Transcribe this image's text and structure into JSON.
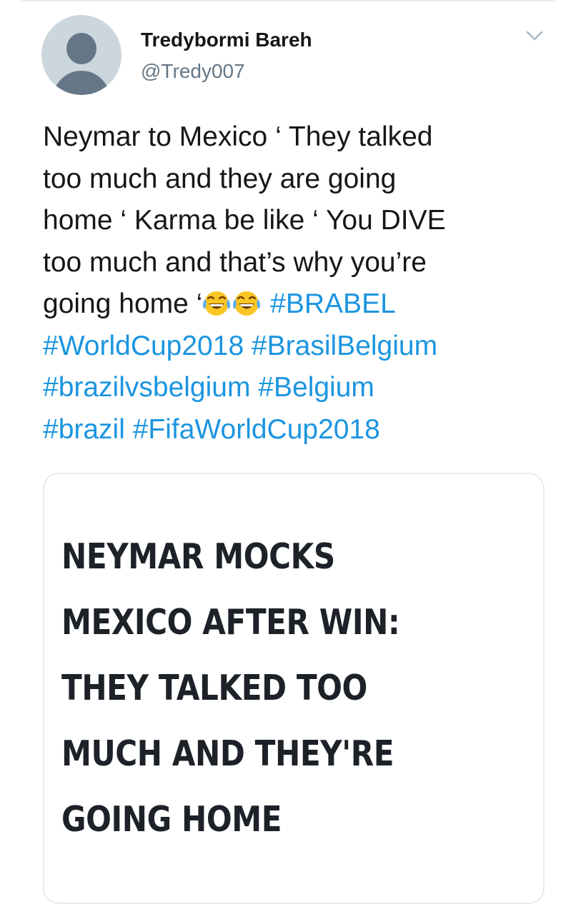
{
  "author": {
    "display_name": "Tredybormi Bareh",
    "handle": "@Tredy007"
  },
  "tweet": {
    "lines": [
      {
        "text": "Neymar to Mexico ‘ They talked"
      },
      {
        "text": "too much and they are going"
      },
      {
        "text": "home ‘ Karma be like ‘ You DIVE"
      },
      {
        "text": "too much and that’s why you’re"
      },
      {
        "text": "going home ‘",
        "emoji": [
          "face-with-tears-of-joy-icon",
          "face-with-tears-of-joy-icon"
        ],
        "hashtag": "#BRABEL"
      }
    ],
    "hashtag_lines": [
      "#WorldCup2018 #BrasilBelgium",
      "#brazilvsbelgium #Belgium",
      "#brazil #FifaWorldCup2018"
    ]
  },
  "card": {
    "headline_lines": [
      "NEYMAR MOCKS",
      "MEXICO AFTER WIN:",
      "THEY TALKED TOO",
      "MUCH AND THEY'RE",
      "GOING HOME"
    ]
  },
  "icons": {
    "more_menu": "chevron-down-icon",
    "avatar": "default-avatar-icon"
  },
  "colors": {
    "hashtag": "#1b95e0",
    "text": "#14171a",
    "secondary_text": "#657786",
    "avatar_bg": "#ccd6dd",
    "avatar_figure": "#657786",
    "border": "#e6ecf0"
  }
}
